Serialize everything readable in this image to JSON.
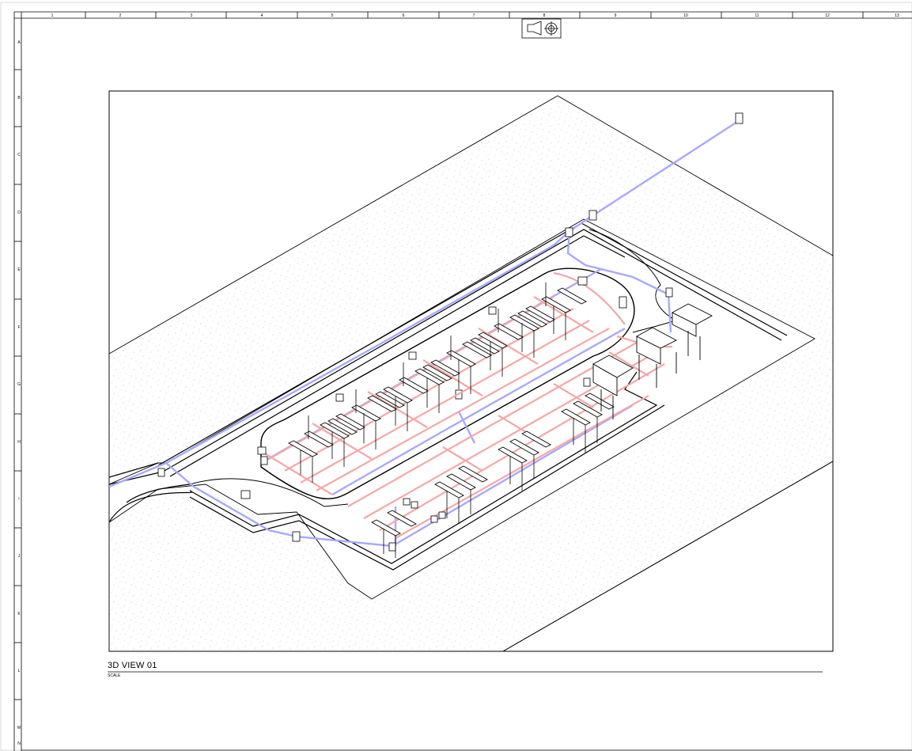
{
  "sheet": {
    "grid_columns": [
      "1",
      "2",
      "3",
      "4",
      "5",
      "6",
      "7",
      "8",
      "9",
      "10",
      "11",
      "12",
      "13"
    ],
    "grid_rows": [
      "A",
      "B",
      "C",
      "D",
      "E",
      "F",
      "G",
      "H",
      "I",
      "J",
      "K",
      "L",
      "M",
      "N"
    ]
  },
  "view": {
    "title": "3D VIEW 01",
    "scale_label": "SCALE",
    "view_control_icon": "camera-viewcube-icon"
  },
  "colors": {
    "line": "#000000",
    "stormwater": "#a8a8ff",
    "sanitary": "#f4a8a8",
    "paper": "#ffffff",
    "ground_speckle": "#bdbdbd"
  }
}
